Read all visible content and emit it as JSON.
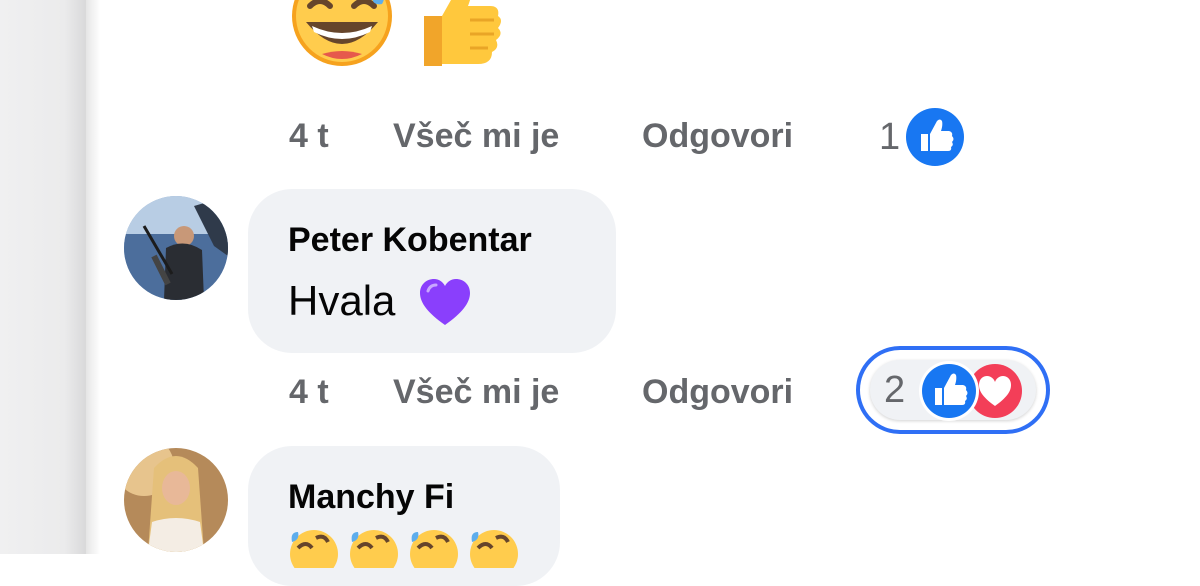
{
  "thread": {
    "top_comment": {
      "time": "4 t",
      "like_label": "Všeč mi je",
      "reply_label": "Odgovori",
      "reaction_count": "1",
      "reaction_icons": [
        "like-icon"
      ]
    },
    "comments": [
      {
        "author": "Peter Kobentar",
        "text": "Hvala",
        "text_emoji": "purple-heart-icon",
        "time": "4 t",
        "like_label": "Všeč mi je",
        "reply_label": "Odgovori",
        "reaction_count": "2",
        "reaction_icons": [
          "like-icon",
          "love-icon"
        ]
      },
      {
        "author": "Manchy Fi",
        "text_emoji": "rolling-laughing-face-icon"
      }
    ]
  },
  "colors": {
    "like_blue": "#1877f2",
    "love_red": "#f33e58",
    "meta_gray": "#65676b",
    "bubble_bg": "#f0f2f5",
    "focus_ring": "#2f6ff5",
    "purple_heart": "#8a3ffc"
  }
}
